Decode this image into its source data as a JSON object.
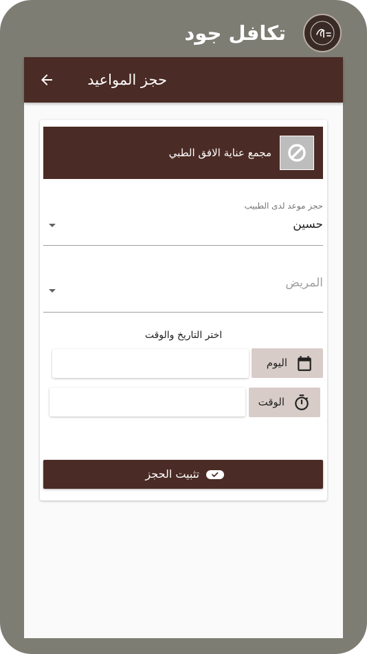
{
  "app": {
    "title": "تكافل جود"
  },
  "appbar": {
    "title": "حجز المواعيد"
  },
  "clinic": {
    "name": "مجمع عناية الافق الطبي",
    "image_icon": "no-image-icon"
  },
  "doctor_field": {
    "label": "حجز موعد لدى الطبيب",
    "value": "حسين"
  },
  "patient_field": {
    "placeholder": "المريض"
  },
  "datetime": {
    "heading": "اختر التاريخ والوقت",
    "day_button": "اليوم",
    "time_button": "الوقت",
    "day_value": "",
    "time_value": ""
  },
  "confirm": {
    "label": "تثبيت الحجز"
  },
  "colors": {
    "primary": "#4b2b25",
    "frame": "#7e7d74",
    "button_light": "#d8ccc8"
  }
}
